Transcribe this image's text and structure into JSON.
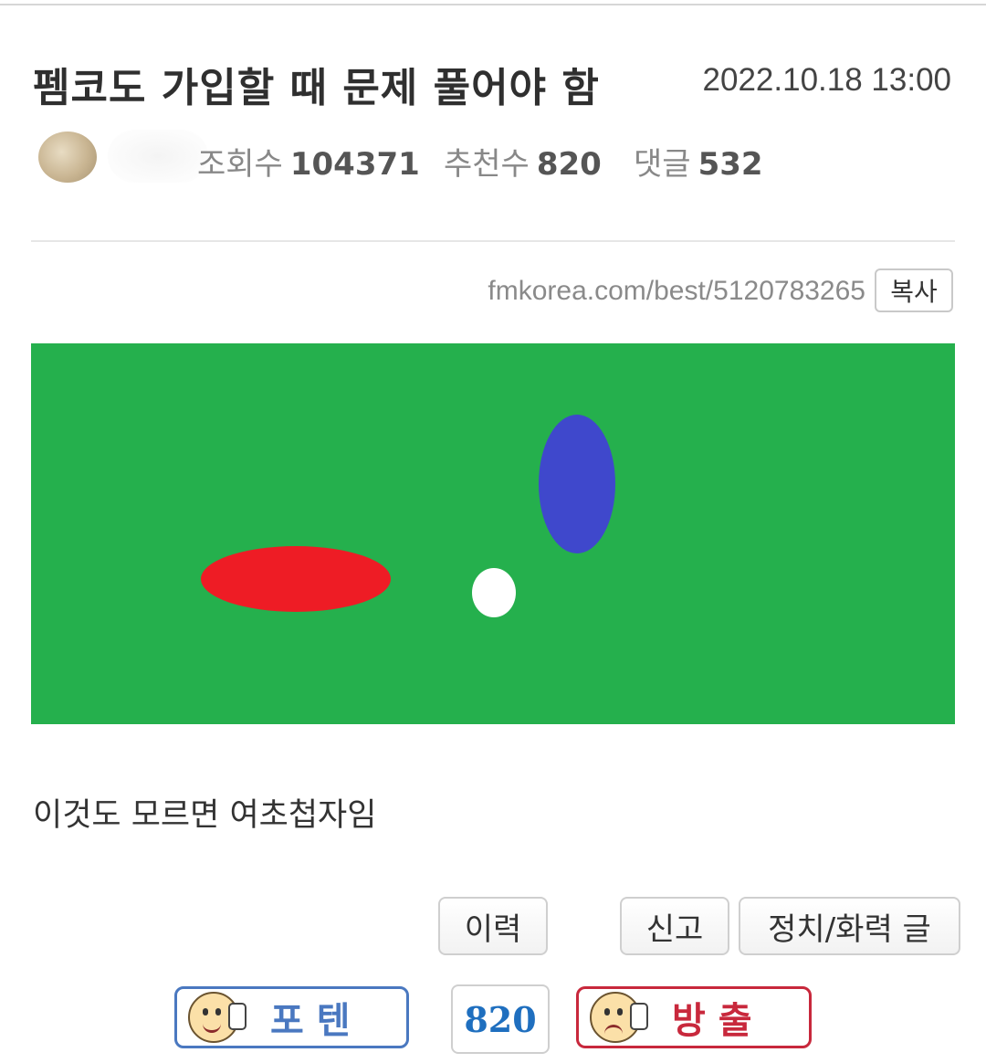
{
  "post": {
    "title": "펨코도 가입할 때 문제 풀어야 함",
    "date": "2022.10.18 13:00",
    "stats": {
      "views_label": "조회수",
      "views": "104371",
      "recommends_label": "추천수",
      "recommends": "820",
      "comments_label": "댓글",
      "comments": "532"
    },
    "url": "fmkorea.com/best/5120783265",
    "copy_label": "복사",
    "body_text": "이것도 모르면 여초첩자임"
  },
  "figure": {
    "background": "#25b04d",
    "shapes": [
      {
        "name": "red-ellipse",
        "color": "#ee1c25"
      },
      {
        "name": "white-circle",
        "color": "#ffffff"
      },
      {
        "name": "blue-ellipse",
        "color": "#3f48cc"
      }
    ]
  },
  "actions": {
    "history": "이력",
    "report": "신고",
    "politics": "정치/화력 글"
  },
  "votes": {
    "up_label": "포텐",
    "up_color": "#4a78c0",
    "count": "820",
    "down_label": "방출",
    "down_color": "#c8283c"
  }
}
